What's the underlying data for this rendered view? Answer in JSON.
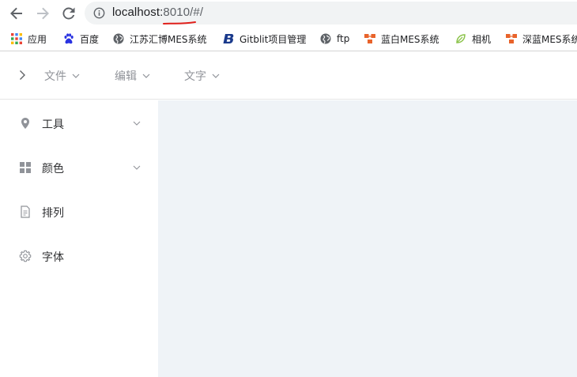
{
  "browser": {
    "url_host": "localhost:",
    "url_rest": "8010/#/",
    "bookmarks": [
      {
        "label": "应用",
        "icon": "apps-grid-icon"
      },
      {
        "label": "百度",
        "icon": "baidu-paw-icon"
      },
      {
        "label": "江苏汇博MES系统",
        "icon": "globe-icon"
      },
      {
        "label": "Gitblit项目管理",
        "icon": "gitblit-icon"
      },
      {
        "label": "ftp",
        "icon": "globe-icon"
      },
      {
        "label": "蓝白MES系统",
        "icon": "orange-blocks-icon"
      },
      {
        "label": "相机",
        "icon": "leaf-icon"
      },
      {
        "label": "深蓝MES系统",
        "icon": "orange-blocks-icon"
      }
    ]
  },
  "header": {
    "menus": [
      {
        "label": "文件"
      },
      {
        "label": "编辑"
      },
      {
        "label": "文字"
      }
    ]
  },
  "sidebar": {
    "items": [
      {
        "label": "工具",
        "icon": "location-pin-icon",
        "has_submenu": true
      },
      {
        "label": "颜色",
        "icon": "grid-icon",
        "has_submenu": true
      },
      {
        "label": "排列",
        "icon": "document-icon",
        "has_submenu": false
      },
      {
        "label": "字体",
        "icon": "gear-icon",
        "has_submenu": false
      }
    ]
  },
  "colors": {
    "main_background": "#eff3f7",
    "menu_text": "#909399",
    "url_annotation": "#e0201b",
    "bookmark_orange": "#e8632b"
  }
}
